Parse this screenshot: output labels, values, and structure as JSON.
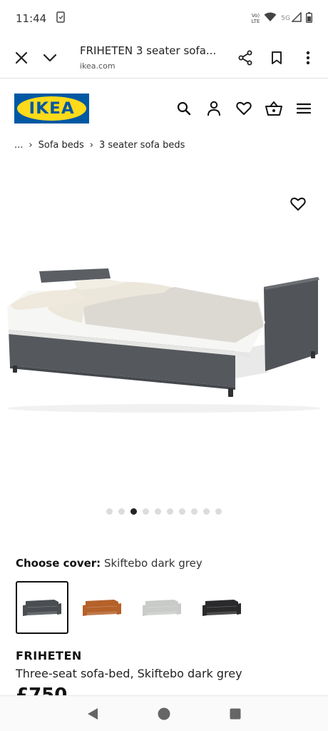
{
  "status_bar": {
    "time": "11:44",
    "network_top": "Vo)",
    "network_bottom": "LTE",
    "signal_type": "5G",
    "icons": [
      "screenshot-icon",
      "wifi-icon",
      "signal-icon",
      "battery-icon"
    ]
  },
  "browser": {
    "title": "FRIHETEN 3 seater sofa...",
    "url": "ikea.com",
    "icons": [
      "close-icon",
      "chevron-down-icon",
      "share-icon",
      "bookmark-icon",
      "more-vert-icon"
    ]
  },
  "header": {
    "logo_text": "IKEA",
    "icons": [
      "search-icon",
      "account-icon",
      "heart-icon",
      "basket-icon",
      "menu-icon"
    ],
    "colors": {
      "logo_blue": "#0058a3",
      "logo_yellow": "#ffda1a"
    }
  },
  "breadcrumb": {
    "ellipsis": "...",
    "separator": "›",
    "items": [
      "Sofa beds",
      "3 seater sofa beds"
    ]
  },
  "gallery": {
    "image_count": 10,
    "active_index": 2
  },
  "cover": {
    "label": "Choose cover:",
    "value": "Skiftebo dark grey",
    "options": [
      {
        "color": "#4a4d52",
        "selected": true
      },
      {
        "color": "#b5612a",
        "selected": false
      },
      {
        "color": "#c9cbc8",
        "selected": false
      },
      {
        "color": "#2a2a2c",
        "selected": false
      }
    ]
  },
  "product": {
    "name": "FRIHETEN",
    "description": "Three-seat sofa-bed, Skiftebo dark grey",
    "price_partial": "£750"
  },
  "nav": {
    "icons": [
      "back-icon",
      "home-icon",
      "recents-icon"
    ]
  }
}
